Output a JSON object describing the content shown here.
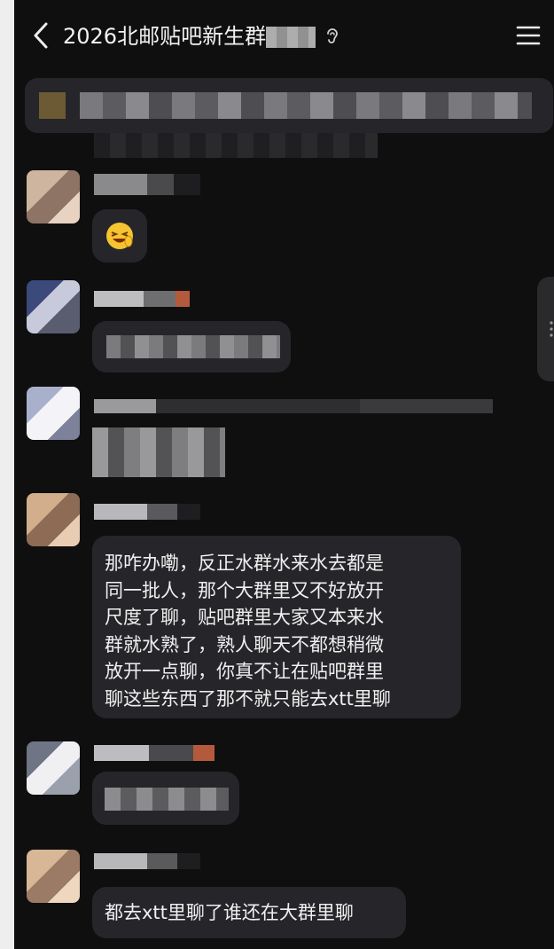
{
  "header": {
    "title": "2026北邮贴吧新生群",
    "back_icon": "chevron-left-icon",
    "listen_icon": "ear-icon",
    "menu_icon": "hamburger-menu-icon"
  },
  "messages": [
    {
      "type": "sticker",
      "sticker": "laughing-emoji"
    },
    {
      "type": "text",
      "text": "那咋办嘞，反正水群水来水去都是\n同一批人，那个大群里又不好放开\n尺度了聊，贴吧群里大家又本来水\n群就水熟了，熟人聊天不都想稍微\n放开一点聊，你真不让在贴吧群里\n聊这些东西了那不就只能去xtt里聊"
    },
    {
      "type": "text",
      "text": "都去xtt里聊了谁还在大群里聊"
    }
  ],
  "colors": {
    "background": "#0f0f10",
    "bubble": "#26262a",
    "text": "#f0f0f0"
  }
}
